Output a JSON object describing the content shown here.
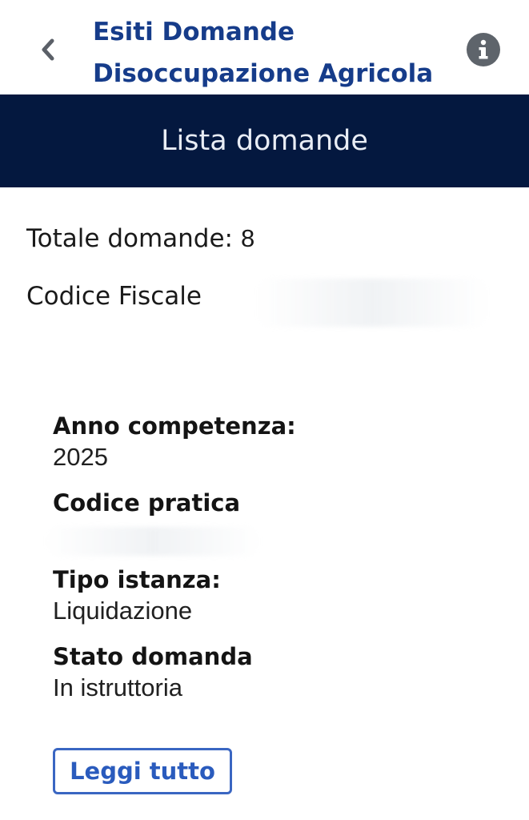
{
  "header": {
    "title_line1": "Esiti Domande",
    "title_line2": "Disoccupazione Agricola",
    "back_icon": "chevron-left-icon",
    "info_icon": "info-icon"
  },
  "banner": {
    "title": "Lista domande"
  },
  "summary": {
    "total_label": "Totale domande:",
    "total_value": "8",
    "codice_fiscale_label": "Codice Fiscale"
  },
  "application": {
    "anno_label": "Anno competenza:",
    "anno_value": "2025",
    "codice_pratica_label": "Codice pratica",
    "tipo_label": "Tipo istanza:",
    "tipo_value": "Liquidazione",
    "stato_label": "Stato domanda",
    "stato_value": "In istruttoria",
    "read_more_label": "Leggi tutto"
  },
  "colors": {
    "title_blue": "#163c8a",
    "banner_navy": "#04183f",
    "button_blue": "#2a5bbd",
    "info_gray": "#5e646b"
  }
}
